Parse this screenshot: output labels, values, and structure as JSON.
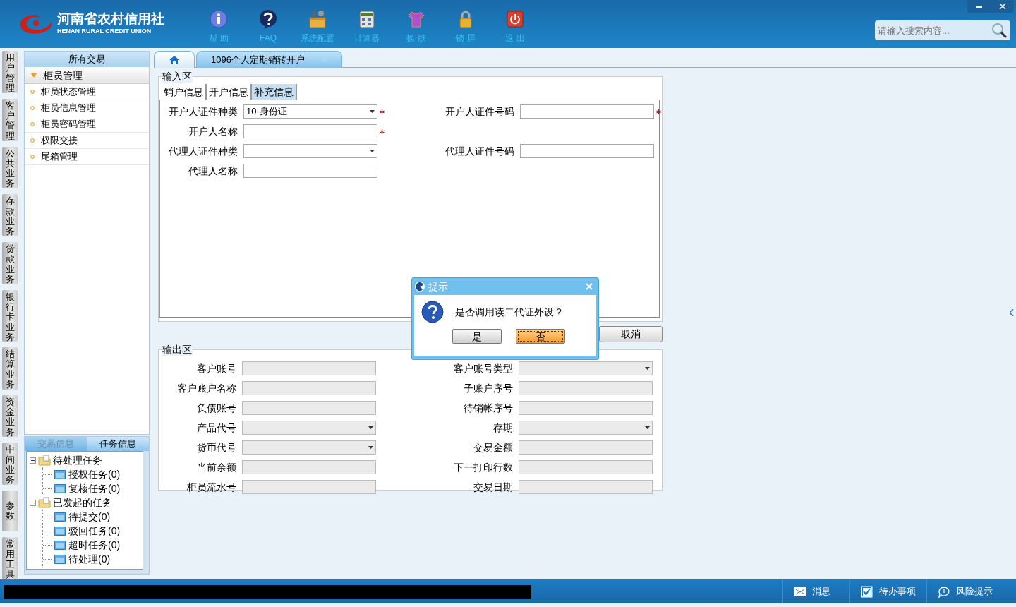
{
  "header": {
    "logo": {
      "name_cn": "河南省农村信用社",
      "name_en": "HENAN RURAL CREDIT UNION"
    },
    "toolbar": [
      {
        "label": "帮 助",
        "kind": "info"
      },
      {
        "label": "FAQ",
        "kind": "faq"
      },
      {
        "label": "系统配置",
        "kind": "config"
      },
      {
        "label": "计算器",
        "kind": "calculator"
      },
      {
        "label": "换 肤",
        "kind": "skin"
      },
      {
        "label": "锁 屏",
        "kind": "lock"
      },
      {
        "label": "退 出",
        "kind": "exit"
      }
    ],
    "search": {
      "placeholder": "请输入搜索内容..."
    }
  },
  "side_tabs": [
    {
      "label": "用户管理"
    },
    {
      "label": "客户管理"
    },
    {
      "label": "公共业务"
    },
    {
      "label": "存款业务"
    },
    {
      "label": "贷款业务"
    },
    {
      "label": "银行卡业务"
    },
    {
      "label": "结算业务"
    },
    {
      "label": "资金业务"
    },
    {
      "label": "中间业务"
    },
    {
      "label": "参数"
    },
    {
      "label": "常用工具"
    }
  ],
  "sidebar": {
    "title": "所有交易",
    "group": {
      "label": "柜员管理",
      "expanded": true,
      "items": [
        "柜员状态管理",
        "柜员信息管理",
        "柜员密码管理",
        "权限交接",
        "尾箱管理"
      ]
    }
  },
  "task_panel": {
    "tabs": [
      {
        "label": "交易信息",
        "selected": false
      },
      {
        "label": "任务信息",
        "selected": true
      }
    ],
    "tree": [
      {
        "label": "待处理任务",
        "expanded": true,
        "children": [
          {
            "label": "授权任务(0)"
          },
          {
            "label": "复核任务(0)"
          }
        ]
      },
      {
        "label": "已发起的任务",
        "expanded": true,
        "children": [
          {
            "label": "待提交(0)"
          },
          {
            "label": "驳回任务(0)"
          },
          {
            "label": "超时任务(0)"
          },
          {
            "label": "待处理(0)"
          }
        ]
      }
    ]
  },
  "doc_tabs": [
    {
      "kind": "home",
      "selected": false
    },
    {
      "kind": "page",
      "label": "1096个人定期销转开户",
      "selected": true
    }
  ],
  "input_area": {
    "legend": "输入区",
    "tabs": [
      {
        "label": "销户信息",
        "selected": false
      },
      {
        "label": "开户信息",
        "selected": false
      },
      {
        "label": "补充信息",
        "selected": true
      }
    ],
    "rows": [
      [
        {
          "label": "开户人证件种类",
          "kind": "select",
          "value": "10-身份证",
          "required": true
        },
        {
          "label": "开户人证件号码",
          "kind": "text",
          "required": true
        }
      ],
      [
        {
          "label": "开户人名称",
          "kind": "text",
          "required": true
        }
      ],
      [
        {
          "label": "代理人证件种类",
          "kind": "select",
          "required": false
        },
        {
          "label": "代理人证件号码",
          "kind": "text",
          "required": false
        }
      ],
      [
        {
          "label": "代理人名称",
          "kind": "text",
          "required": false
        }
      ]
    ]
  },
  "buttons": [
    "取消"
  ],
  "output_area": {
    "legend": "输出区",
    "rows": [
      [
        {
          "label": "客户账号",
          "kind": "text"
        },
        {
          "label": "客户账号类型",
          "kind": "select"
        }
      ],
      [
        {
          "label": "客户账户名称",
          "kind": "text"
        },
        {
          "label": "子账户序号",
          "kind": "text"
        }
      ],
      [
        {
          "label": "负债账号",
          "kind": "text"
        },
        {
          "label": "待销帐序号",
          "kind": "text"
        }
      ],
      [
        {
          "label": "产品代号",
          "kind": "select"
        },
        {
          "label": "存期",
          "kind": "select"
        }
      ],
      [
        {
          "label": "货币代号",
          "kind": "select"
        },
        {
          "label": "交易金额",
          "kind": "text"
        }
      ],
      [
        {
          "label": "当前余额",
          "kind": "text"
        },
        {
          "label": "下一打印行数",
          "kind": "text"
        }
      ],
      [
        {
          "label": "柜员流水号",
          "kind": "text"
        },
        {
          "label": "交易日期",
          "kind": "text"
        }
      ]
    ]
  },
  "dialog": {
    "title": "提示",
    "message": "是否调用读二代证外设？",
    "buttons": [
      {
        "label": "是",
        "selected": false
      },
      {
        "label": "否",
        "selected": true
      }
    ]
  },
  "status_bar": {
    "items": [
      {
        "label": "消息",
        "kind": "mail"
      },
      {
        "label": "待办事项",
        "kind": "check"
      },
      {
        "label": "风险提示",
        "kind": "bubble"
      }
    ]
  }
}
